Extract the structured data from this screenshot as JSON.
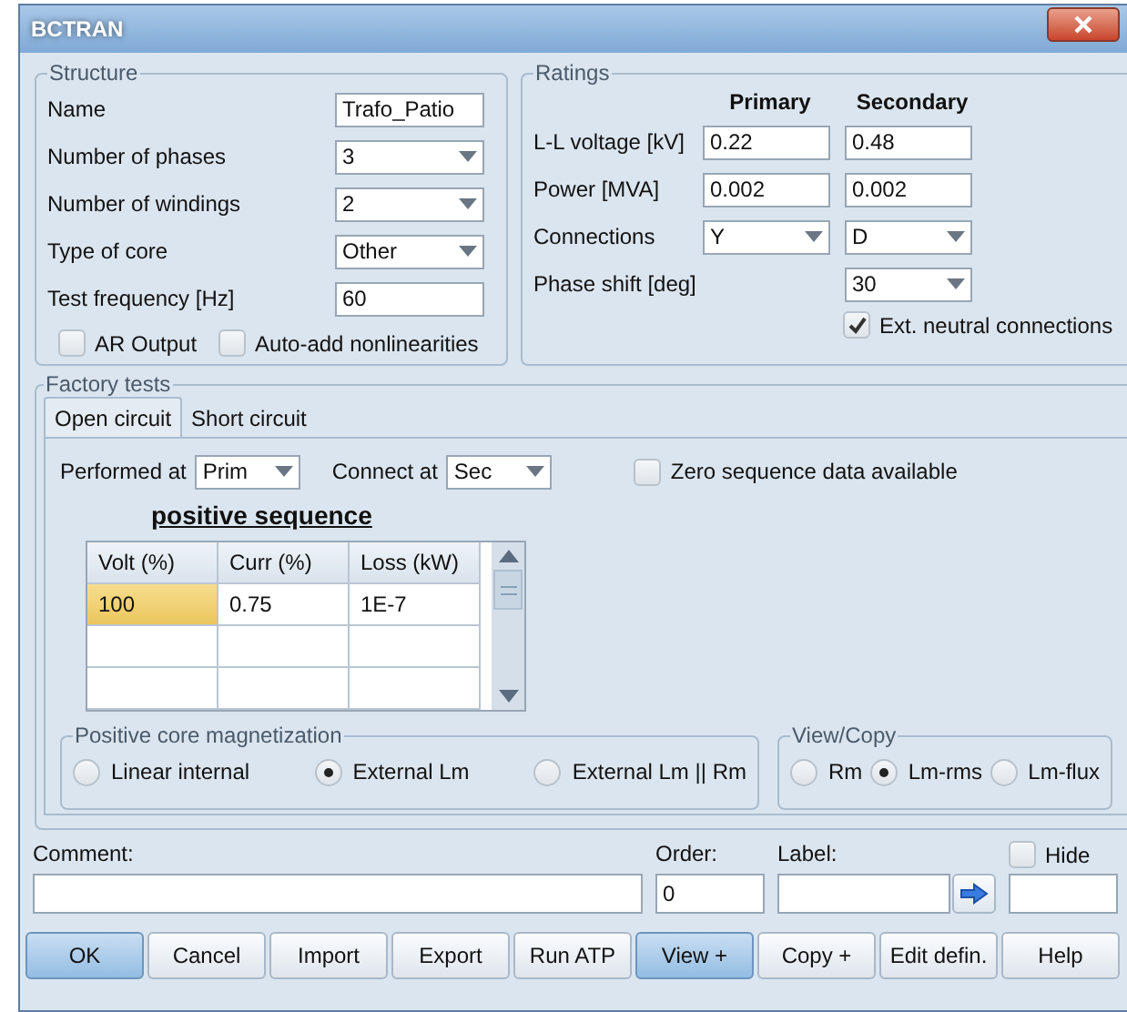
{
  "window": {
    "title": "BCTRAN"
  },
  "structure": {
    "title": "Structure",
    "fields": [
      {
        "label": "Name",
        "kind": "text",
        "value": "Trafo_Patio"
      },
      {
        "label": "Number of phases",
        "kind": "dropdown",
        "value": "3"
      },
      {
        "label": "Number of windings",
        "kind": "dropdown",
        "value": "2"
      },
      {
        "label": "Type of core",
        "kind": "dropdown",
        "value": "Other"
      },
      {
        "label": "Test frequency [Hz]",
        "kind": "text",
        "value": "60"
      }
    ],
    "checkboxes": [
      {
        "label": "AR Output",
        "checked": false
      },
      {
        "label": "Auto-add nonlinearities",
        "checked": false
      }
    ]
  },
  "ratings": {
    "title": "Ratings",
    "columns": [
      "Primary",
      "Secondary"
    ],
    "rows": [
      {
        "label": "L-L voltage [kV]",
        "cells": [
          {
            "kind": "text",
            "value": "0.22"
          },
          {
            "kind": "text",
            "value": "0.48"
          }
        ]
      },
      {
        "label": "Power [MVA]",
        "cells": [
          {
            "kind": "text",
            "value": "0.002"
          },
          {
            "kind": "text",
            "value": "0.002"
          }
        ]
      },
      {
        "label": "Connections",
        "cells": [
          {
            "kind": "dropdown",
            "value": "Y"
          },
          {
            "kind": "dropdown",
            "value": "D"
          }
        ]
      },
      {
        "label": "Phase shift [deg]",
        "cells": [
          {
            "kind": "blank"
          },
          {
            "kind": "dropdown",
            "value": "30"
          }
        ]
      }
    ],
    "checkbox": {
      "label": "Ext. neutral connections",
      "checked": true
    }
  },
  "factory_tests": {
    "title": "Factory tests",
    "tabs": [
      {
        "label": "Open circuit",
        "selected": true
      },
      {
        "label": "Short circuit",
        "selected": false
      }
    ],
    "performed_at": {
      "label": "Performed at",
      "value": "Prim"
    },
    "connect_at": {
      "label": "Connect at",
      "value": "Sec"
    },
    "zero_sequence": {
      "label": "Zero sequence data available",
      "checked": false
    },
    "sequence_title": "positive sequence",
    "table": {
      "columns": [
        "Volt (%)",
        "Curr (%)",
        "Loss (kW)"
      ],
      "rows": [
        {
          "cells": [
            {
              "text": "100",
              "selected": true
            },
            {
              "text": "0.75",
              "selected": false
            },
            {
              "text": "1E-7",
              "selected": false
            }
          ]
        }
      ]
    },
    "magnetization": {
      "title": "Positive core magnetization",
      "options": [
        {
          "label": "Linear internal",
          "selected": false
        },
        {
          "label": "External Lm",
          "selected": true
        },
        {
          "label": "External  Lm || Rm",
          "selected": false
        }
      ]
    },
    "view_copy": {
      "title": "View/Copy",
      "options": [
        {
          "label": "Rm",
          "selected": false
        },
        {
          "label": "Lm-rms",
          "selected": true
        },
        {
          "label": "Lm-flux",
          "selected": false
        }
      ]
    }
  },
  "comment": {
    "label": "Comment:"
  },
  "order": {
    "label": "Order:",
    "value": "0"
  },
  "label_field": {
    "label": "Label:"
  },
  "hide": {
    "label": "Hide",
    "checked": false
  },
  "buttons": [
    {
      "label": "OK",
      "highlighted": true
    },
    {
      "label": "Cancel",
      "highlighted": false
    },
    {
      "label": "Import",
      "highlighted": false
    },
    {
      "label": "Export",
      "highlighted": false
    },
    {
      "label": "Run ATP",
      "highlighted": false
    },
    {
      "label": "View +",
      "highlighted": true
    },
    {
      "label": "Copy +",
      "highlighted": false
    },
    {
      "label": "Edit defin.",
      "highlighted": false
    },
    {
      "label": "Help",
      "highlighted": false
    }
  ]
}
